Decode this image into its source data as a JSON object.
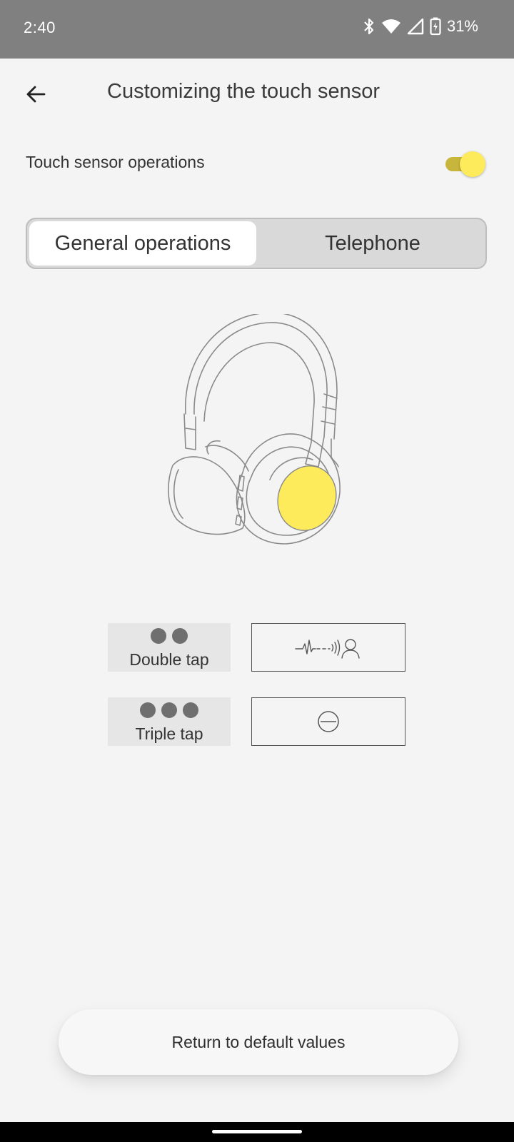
{
  "status_bar": {
    "time": "2:40",
    "battery": "31%",
    "icons": [
      "bluetooth-icon",
      "wifi-icon",
      "signal-icon",
      "battery-charging-icon"
    ]
  },
  "app_bar": {
    "title": "Customizing the touch sensor",
    "back_icon": "arrow-left-icon"
  },
  "touch_sensor": {
    "label": "Touch sensor operations",
    "enabled": true
  },
  "tabs": [
    {
      "label": "General operations",
      "selected": true
    },
    {
      "label": "Telephone",
      "selected": false
    }
  ],
  "taps": [
    {
      "dots": 2,
      "label": "Double tap",
      "action_icon": "ambient-sound-icon"
    },
    {
      "dots": 3,
      "label": "Triple tap",
      "action_icon": "no-function-icon"
    }
  ],
  "reset_button": {
    "label": "Return to default values"
  },
  "colors": {
    "accent": "#fdeb5b",
    "accent_track": "#c8b63c",
    "status_bar": "#808080",
    "background": "#f4f4f4"
  }
}
